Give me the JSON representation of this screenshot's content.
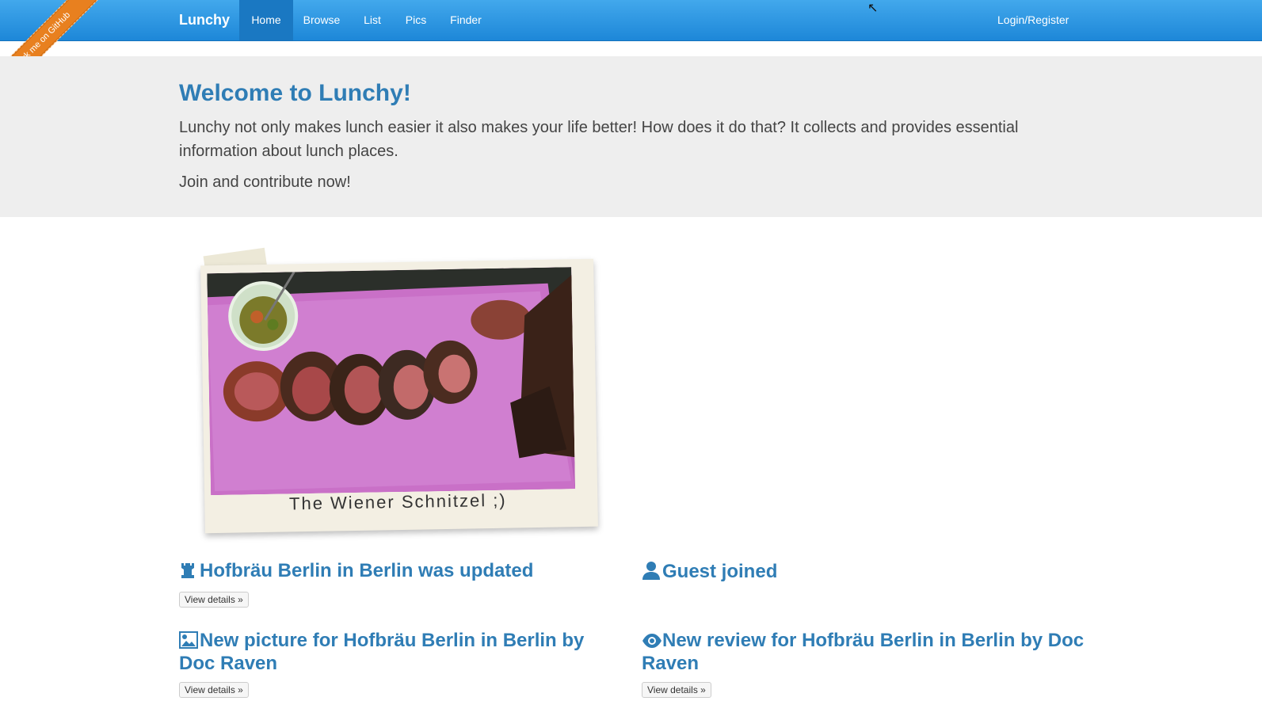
{
  "navbar": {
    "brand": "Lunchy",
    "items": [
      {
        "label": "Home"
      },
      {
        "label": "Browse"
      },
      {
        "label": "List"
      },
      {
        "label": "Pics"
      },
      {
        "label": "Finder"
      }
    ],
    "login": "Login/Register"
  },
  "ribbon": {
    "label": "Fork me on GitHub"
  },
  "jumbotron": {
    "title": "Welcome to Lunchy!",
    "lead": "Lunchy not only makes lunch easier it also makes your life better! How does it do that? It collects and provides essential information about lunch places.",
    "join": "Join and contribute now!"
  },
  "featured": {
    "caption": "The Wiener Schnitzel ;)"
  },
  "activities": [
    {
      "icon": "chess-rook-icon",
      "text": "Hofbräu Berlin in Berlin was updated",
      "button": "View details »"
    },
    {
      "icon": "user-icon",
      "text": "Guest joined",
      "button": ""
    },
    {
      "icon": "picture-icon",
      "text": "New picture for Hofbräu Berlin in Berlin by Doc Raven",
      "button": "View details »"
    },
    {
      "icon": "eye-icon",
      "text": "New review for Hofbräu Berlin in Berlin by Doc Raven",
      "button": "View details »"
    }
  ],
  "colors": {
    "navbar": "#2a94e0",
    "heading": "#2f7db5",
    "ribbon": "#e8801f",
    "jumbotron_bg": "#eeeeee"
  }
}
